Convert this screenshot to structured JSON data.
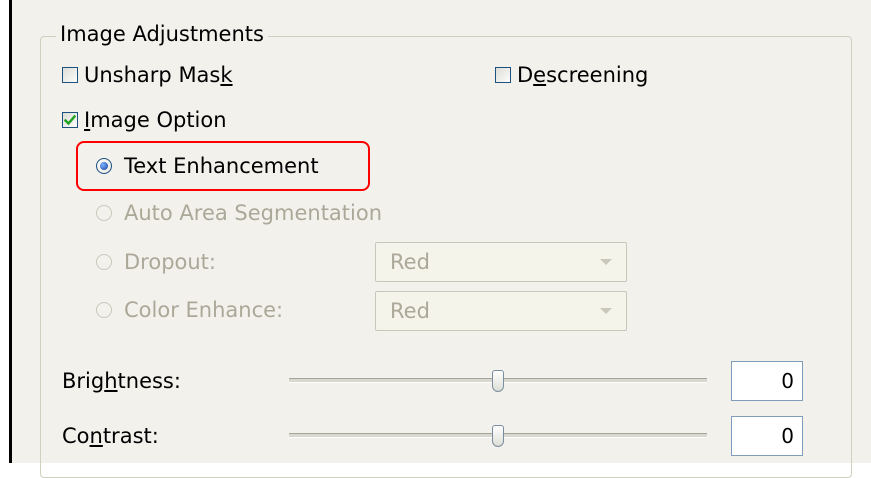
{
  "group_title": "Image Adjustments",
  "checkboxes": {
    "unsharp_mask": {
      "label_pre": "Unsharp Mas",
      "label_u": "k",
      "label_post": "",
      "checked": false
    },
    "descreening": {
      "label_pre": "D",
      "label_u": "e",
      "label_post": "screening",
      "checked": false
    },
    "image_option": {
      "label_pre": "",
      "label_u": "I",
      "label_post": "mage Option",
      "checked": true
    }
  },
  "options": {
    "text_enhancement": {
      "label": "Text Enhancement",
      "selected": true,
      "enabled": true
    },
    "auto_area_segmentation": {
      "label": "Auto Area Segmentation",
      "selected": false,
      "enabled": false
    },
    "dropout": {
      "label": "Dropout:",
      "selected": false,
      "enabled": false,
      "value": "Red"
    },
    "color_enhance": {
      "label": "Color Enhance:",
      "selected": false,
      "enabled": false,
      "value": "Red"
    }
  },
  "sliders": {
    "brightness": {
      "label_pre": "Brig",
      "label_u": "h",
      "label_post": "tness:",
      "value": "0",
      "level": 0.5
    },
    "contrast": {
      "label_pre": "Co",
      "label_u": "n",
      "label_post": "trast:",
      "value": "0",
      "level": 0.5
    }
  },
  "colors": {
    "highlight": "#ff0000",
    "check": "#21a121",
    "disabled_text": "#aca899"
  }
}
